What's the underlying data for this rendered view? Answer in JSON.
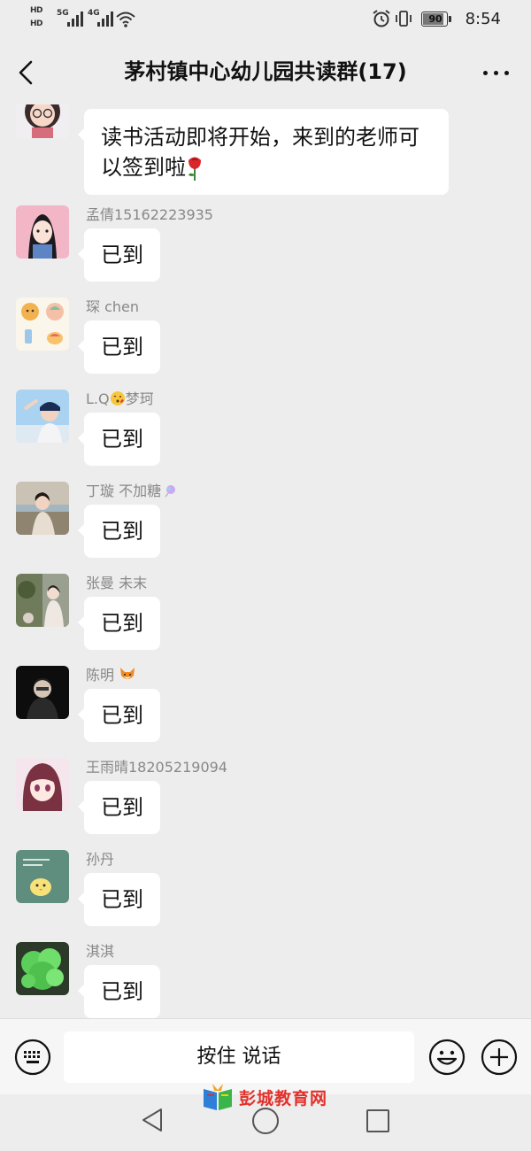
{
  "status_bar": {
    "hd_top": "HD",
    "hd_bottom": "HD",
    "network1": "5G",
    "network2": "4G",
    "battery_level": "90",
    "battery_fraction": 0.9,
    "time": "8:54"
  },
  "header": {
    "title": "茅村镇中心幼儿园共读群(17)"
  },
  "messages": [
    {
      "sender": "",
      "text": "读书活动即将开始，来到的老师可以签到啦",
      "emoji": "rose-icon"
    },
    {
      "sender": "孟倩15162223935",
      "text": "已到"
    },
    {
      "sender": "琛  chen",
      "text": "已到"
    },
    {
      "sender": "L.Q",
      "sender_suffix": "梦珂",
      "sender_emoji": "kissing-face-icon",
      "text": "已到"
    },
    {
      "sender": "丁璇   不加糖",
      "sender_emoji": "candy-icon",
      "text": "已到"
    },
    {
      "sender": "张曼  未末",
      "text": "已到"
    },
    {
      "sender": "陈明  ",
      "sender_emoji": "fox-icon",
      "text": "已到"
    },
    {
      "sender": "王雨晴18205219094",
      "text": "已到"
    },
    {
      "sender": "孙丹",
      "text": "已到"
    },
    {
      "sender": "淇淇",
      "text": "已到"
    }
  ],
  "input_bar": {
    "hold_to_talk": "按住 说话"
  },
  "watermark": {
    "text": "彭城教育网"
  },
  "colors": {
    "background": "#ededed",
    "bubble": "#ffffff",
    "sender_name": "#888888",
    "watermark_red": "#e2302a"
  }
}
